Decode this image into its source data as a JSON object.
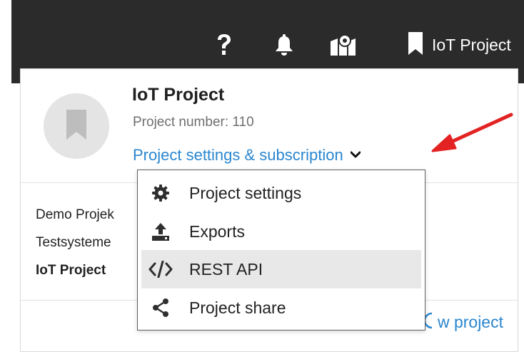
{
  "topbar": {
    "help_icon": "question-mark-icon",
    "notifications_icon": "bell-icon",
    "map_icon": "map-pin-icon",
    "project_icon": "bookmark-icon",
    "project_label": "IoT Project"
  },
  "project_card": {
    "avatar_icon": "bookmark-icon",
    "name": "IoT Project",
    "number": "Project number: 110",
    "settings_link": "Project settings & subscription",
    "settings_chevron": "chevron-down-icon",
    "project_list": [
      {
        "label": "Demo Projek",
        "bold": false
      },
      {
        "label": "Testsysteme",
        "bold": false
      },
      {
        "label": "IoT Project",
        "bold": true
      }
    ],
    "new_project_label": "w project"
  },
  "dropdown": {
    "items": [
      {
        "label": "Project settings",
        "icon": "gear-icon",
        "highlighted": false
      },
      {
        "label": "Exports",
        "icon": "upload-icon",
        "highlighted": false
      },
      {
        "label": "REST API",
        "icon": "code-icon",
        "highlighted": true
      },
      {
        "label": "Project share",
        "icon": "share-icon",
        "highlighted": false
      }
    ]
  },
  "colors": {
    "topbar_bg": "#2b2b2b",
    "link": "#2a86cf",
    "annotation_arrow": "#e32222",
    "menu_highlight": "#e8e8e8"
  }
}
